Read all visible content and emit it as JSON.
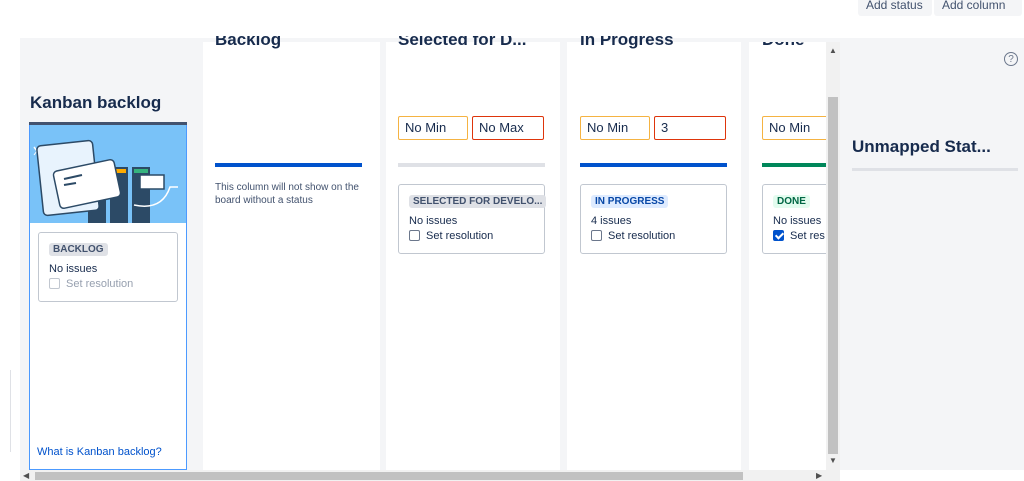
{
  "toolbar": {
    "add_status": "Add status",
    "add_column": "Add column"
  },
  "kanban_backlog": {
    "title": "Kanban backlog",
    "card": {
      "lozenge": "BACKLOG",
      "count": "No issues",
      "resolution": "Set resolution",
      "checked": false
    },
    "link": "What is Kanban backlog?"
  },
  "columns": [
    {
      "title": "Backlog",
      "note": "This column will not show on the board without a status",
      "bar_color": "#0052cc"
    },
    {
      "title": "Selected for D...",
      "min": "No Min",
      "max": "No Max",
      "bar_color": "#dfe1e6",
      "card": {
        "lozenge": "SELECTED FOR DEVELO...",
        "count": "No issues",
        "resolution": "Set resolution",
        "checked": false
      }
    },
    {
      "title": "In Progress",
      "min": "No Min",
      "max": "3",
      "bar_color": "#0052cc",
      "card": {
        "lozenge": "IN PROGRESS",
        "count": "4 issues",
        "resolution": "Set resolution",
        "checked": false
      }
    },
    {
      "title": "Done",
      "min": "No Min",
      "bar_color": "#00875a",
      "card": {
        "lozenge": "DONE",
        "count": "No issues",
        "resolution": "Set res",
        "checked": true
      }
    }
  ],
  "unmapped": {
    "title": "Unmapped Stat..."
  },
  "help": {
    "icon": "help-circle-icon",
    "glyph": "?"
  },
  "colors": {
    "accent_blue": "#0052cc",
    "done_green": "#00875a",
    "min_border": "#f5b342",
    "max_border": "#de350b",
    "board_bg": "#f4f5f7"
  }
}
